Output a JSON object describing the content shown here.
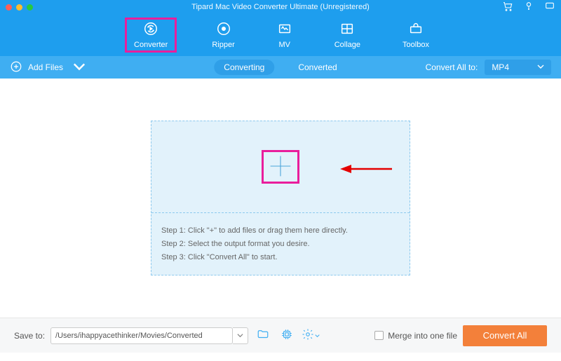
{
  "titlebar": {
    "title": "Tipard Mac Video Converter Ultimate (Unregistered)"
  },
  "nav": {
    "items": [
      {
        "label": "Converter"
      },
      {
        "label": "Ripper"
      },
      {
        "label": "MV"
      },
      {
        "label": "Collage"
      },
      {
        "label": "Toolbox"
      }
    ]
  },
  "subbar": {
    "addFiles": "Add Files",
    "tabs": {
      "converting": "Converting",
      "converted": "Converted"
    },
    "convertAllToLabel": "Convert All to:",
    "format": "MP4"
  },
  "dropzone": {
    "steps": [
      "Step 1: Click \"+\" to add files or drag them here directly.",
      "Step 2: Select the output format you desire.",
      "Step 3: Click \"Convert All\" to start."
    ]
  },
  "footer": {
    "saveToLabel": "Save to:",
    "path": "/Users/ihappyacethinker/Movies/Converted",
    "mergeLabel": "Merge into one file",
    "convertAllBtn": "Convert All"
  }
}
